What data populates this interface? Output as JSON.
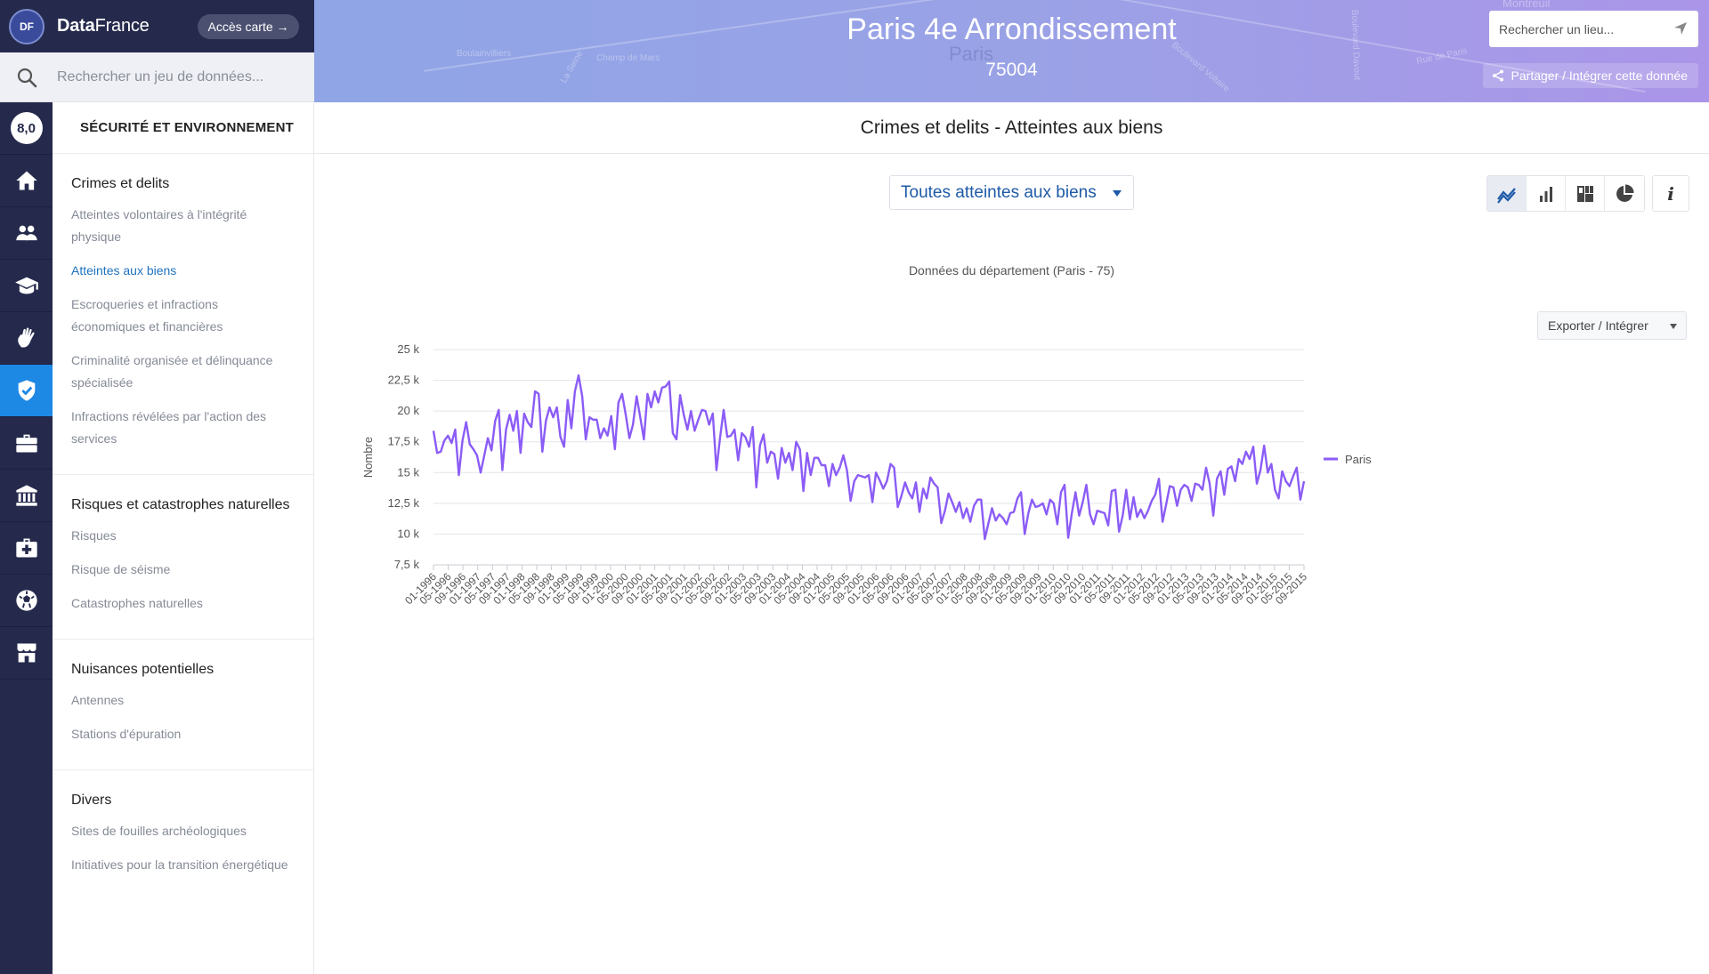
{
  "brand": {
    "logo": "DF",
    "name_bold": "Data",
    "name_rest": "France",
    "map_button": "Accès carte →"
  },
  "dataset_search": {
    "placeholder": "Rechercher un jeu de données..."
  },
  "rail": {
    "score": "8,0",
    "icons": [
      "home-icon",
      "people-icon",
      "graduation-cap-icon",
      "hand-icon",
      "shield-check-icon",
      "briefcase-icon",
      "institution-icon",
      "medical-kit-icon",
      "soccer-ball-icon",
      "shop-icon"
    ],
    "active_icon": "shield-check-icon"
  },
  "nav": {
    "title": "SÉCURITÉ ET ENVIRONNEMENT",
    "groups": [
      {
        "title": "Crimes et delits",
        "items": [
          "Atteintes volontaires à l'intégrité physique",
          "Atteintes aux biens",
          "Escroqueries et infractions économiques et financières",
          "Criminalité organisée et délinquance spécialisée",
          "Infractions révélées par l'action des services"
        ]
      },
      {
        "title": "Risques et catastrophes naturelles",
        "items": [
          "Risques",
          "Risque de séisme",
          "Catastrophes naturelles"
        ]
      },
      {
        "title": "Nuisances potentielles",
        "items": [
          "Antennes",
          "Stations d'épuration"
        ]
      },
      {
        "title": "Divers",
        "items": [
          "Sites de fouilles archéologiques",
          "Initiatives pour la transition énergétique"
        ]
      }
    ],
    "current_item": "Atteintes aux biens"
  },
  "header": {
    "title": "Paris 4e Arrondissement",
    "subtitle": "75004",
    "place_search_placeholder": "Rechercher un lieu...",
    "share_label": "Partager / Intégrer cette donnée",
    "map_labels": [
      "Boulainvilliers",
      "La Seine",
      "Champ de Mars",
      "Paris",
      "Boulevard Voltaire",
      "Boulevard Davout",
      "Rue de Paris",
      "Montreuil"
    ]
  },
  "section": {
    "title": "Crimes et delits - Atteintes aux biens"
  },
  "controls": {
    "dataset_selected": "Toutes atteintes aux biens",
    "view_toggles": [
      "line-chart-icon",
      "bar-chart-icon",
      "treemap-icon",
      "pie-chart-icon"
    ],
    "active_view": "line-chart-icon",
    "info_label": "i",
    "export_label": "Exporter / Intégrer"
  },
  "colors": {
    "series": "#8b5cf6",
    "accent": "#1e88e5",
    "nav_dark": "#252a4d",
    "link_active": "#1e73be"
  },
  "chart_data": {
    "type": "line",
    "title": "Données du département (Paris - 75)",
    "xlabel": "",
    "ylabel": "Nombre",
    "ylim": [
      7500,
      25000
    ],
    "yticks": [
      7500,
      10000,
      12500,
      15000,
      17500,
      20000,
      22500,
      25000
    ],
    "ytick_labels": [
      "7,5 k",
      "10 k",
      "12,5 k",
      "15 k",
      "17,5 k",
      "20 k",
      "22,5 k",
      "25 k"
    ],
    "x_start": "01-1996",
    "x_tick_labels": [
      "01-1996",
      "05-1996",
      "09-1996",
      "01-1997",
      "05-1997",
      "09-1997",
      "01-1998",
      "05-1998",
      "09-1998",
      "01-1999",
      "05-1999",
      "09-1999",
      "01-2000",
      "05-2000",
      "09-2000",
      "01-2001",
      "05-2001",
      "09-2001",
      "01-2002",
      "05-2002",
      "09-2002",
      "01-2003",
      "05-2003",
      "09-2003",
      "01-2004",
      "05-2004",
      "09-2004",
      "01-2005",
      "05-2005",
      "09-2005",
      "01-2006",
      "05-2006",
      "09-2006",
      "01-2007",
      "05-2007",
      "09-2007",
      "01-2008",
      "05-2008",
      "09-2008",
      "01-2009",
      "05-2009",
      "09-2009",
      "01-2010",
      "05-2010",
      "09-2010",
      "01-2011",
      "05-2011",
      "09-2011",
      "01-2012",
      "05-2012",
      "09-2012",
      "01-2013",
      "05-2013",
      "09-2013",
      "01-2014",
      "05-2014",
      "09-2014",
      "01-2015",
      "05-2015",
      "09-2015"
    ],
    "grid": true,
    "legend": "right",
    "series": [
      {
        "name": "Paris",
        "values": [
          18400,
          16600,
          16700,
          17600,
          18000,
          17400,
          18500,
          14800,
          17600,
          19100,
          17300,
          16900,
          16400,
          15000,
          16400,
          17800,
          16800,
          19200,
          20100,
          15200,
          18500,
          19700,
          18400,
          20000,
          16600,
          19800,
          19100,
          18700,
          21600,
          21400,
          16700,
          19200,
          20300,
          19500,
          20300,
          17900,
          17100,
          20900,
          18600,
          21600,
          22900,
          21200,
          17700,
          19500,
          19300,
          19300,
          17800,
          18600,
          18000,
          19600,
          16900,
          20700,
          21400,
          19700,
          17800,
          18900,
          21200,
          19500,
          17700,
          21400,
          20300,
          21600,
          20700,
          21900,
          22000,
          22400,
          18200,
          17700,
          21300,
          19700,
          18500,
          20000,
          18400,
          19300,
          20100,
          20000,
          18900,
          19800,
          15200,
          17800,
          20100,
          17900,
          18000,
          18500,
          16000,
          18200,
          17900,
          17100,
          18700,
          13800,
          17200,
          18100,
          15800,
          16700,
          16500,
          14500,
          17000,
          15800,
          16600,
          15200,
          17500,
          16900,
          13500,
          16600,
          14800,
          16200,
          16200,
          15600,
          15600,
          13900,
          15700,
          14800,
          15400,
          16400,
          15200,
          12700,
          14300,
          14800,
          14700,
          14600,
          14800,
          12600,
          15000,
          14400,
          13700,
          14300,
          15700,
          15400,
          12200,
          13100,
          14200,
          13400,
          12900,
          14200,
          11800,
          13700,
          12900,
          14600,
          14100,
          13800,
          10900,
          11900,
          13300,
          12600,
          11800,
          12600,
          11300,
          12100,
          11000,
          12300,
          12800,
          12800,
          9600,
          10900,
          12100,
          11100,
          11600,
          11300,
          10800,
          11700,
          11800,
          12900,
          13400,
          10000,
          11700,
          12800,
          12200,
          12300,
          12500,
          11600,
          12800,
          12500,
          10800,
          13400,
          14000,
          9700,
          11700,
          13400,
          11500,
          12600,
          14000,
          11600,
          10800,
          11900,
          11800,
          11700,
          10700,
          13500,
          13600,
          10200,
          11500,
          13600,
          11200,
          13000,
          11400,
          12000,
          11300,
          11900,
          12700,
          13200,
          14500,
          11000,
          12400,
          13900,
          13800,
          12300,
          13600,
          14000,
          13800,
          12700,
          14100,
          14000,
          13600,
          15400,
          14100,
          11500,
          14500,
          15100,
          13200,
          15300,
          15500,
          14300,
          16100,
          15700,
          16700,
          16100,
          17100,
          14100,
          15200,
          17200,
          15000,
          15700,
          13600,
          12900,
          15100,
          14300,
          13900,
          14700,
          15400,
          12800,
          14300
        ]
      }
    ]
  }
}
